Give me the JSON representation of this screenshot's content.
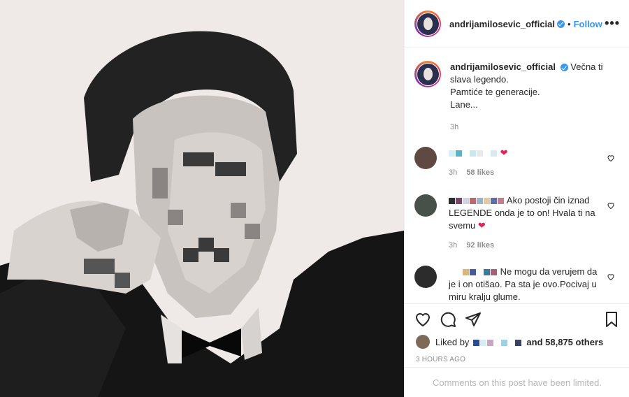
{
  "post": {
    "username": "andrijamilosevic_official",
    "dot": "•",
    "follow_label": "Follow",
    "more_label": "•••",
    "caption_lines": [
      "Večna ti slava legendo.",
      "Pamtiće te generacije.",
      "Lane..."
    ],
    "caption_time": "3h"
  },
  "comments": [
    {
      "text_tail": "",
      "time": "3h",
      "likes": "58 likes",
      "heart": "❤"
    },
    {
      "text_tail": "Ako postoji čin iznad LEGENDE onda je to on! Hvala ti na svemu",
      "time": "3h",
      "likes": "92 likes",
      "heart": "❤"
    },
    {
      "text_tail": "Ne mogu da verujem da je i on otišao. Pa sta je ovo.Pocivaj u miru kralju glume."
    }
  ],
  "actions": {
    "liked_by_prefix": "Liked by",
    "liked_by_suffix": "and 58,875 others",
    "time_ago": "3 HOURS AGO",
    "limited_notice": "Comments on this post have been limited."
  },
  "colors": {
    "accent": "#3897f0",
    "heart": "#e0245e",
    "muted": "#8e8e8e"
  },
  "icons": [
    "like-heart-icon",
    "comment-icon",
    "share-icon",
    "bookmark-icon",
    "verified-badge-icon",
    "more-options-icon"
  ]
}
